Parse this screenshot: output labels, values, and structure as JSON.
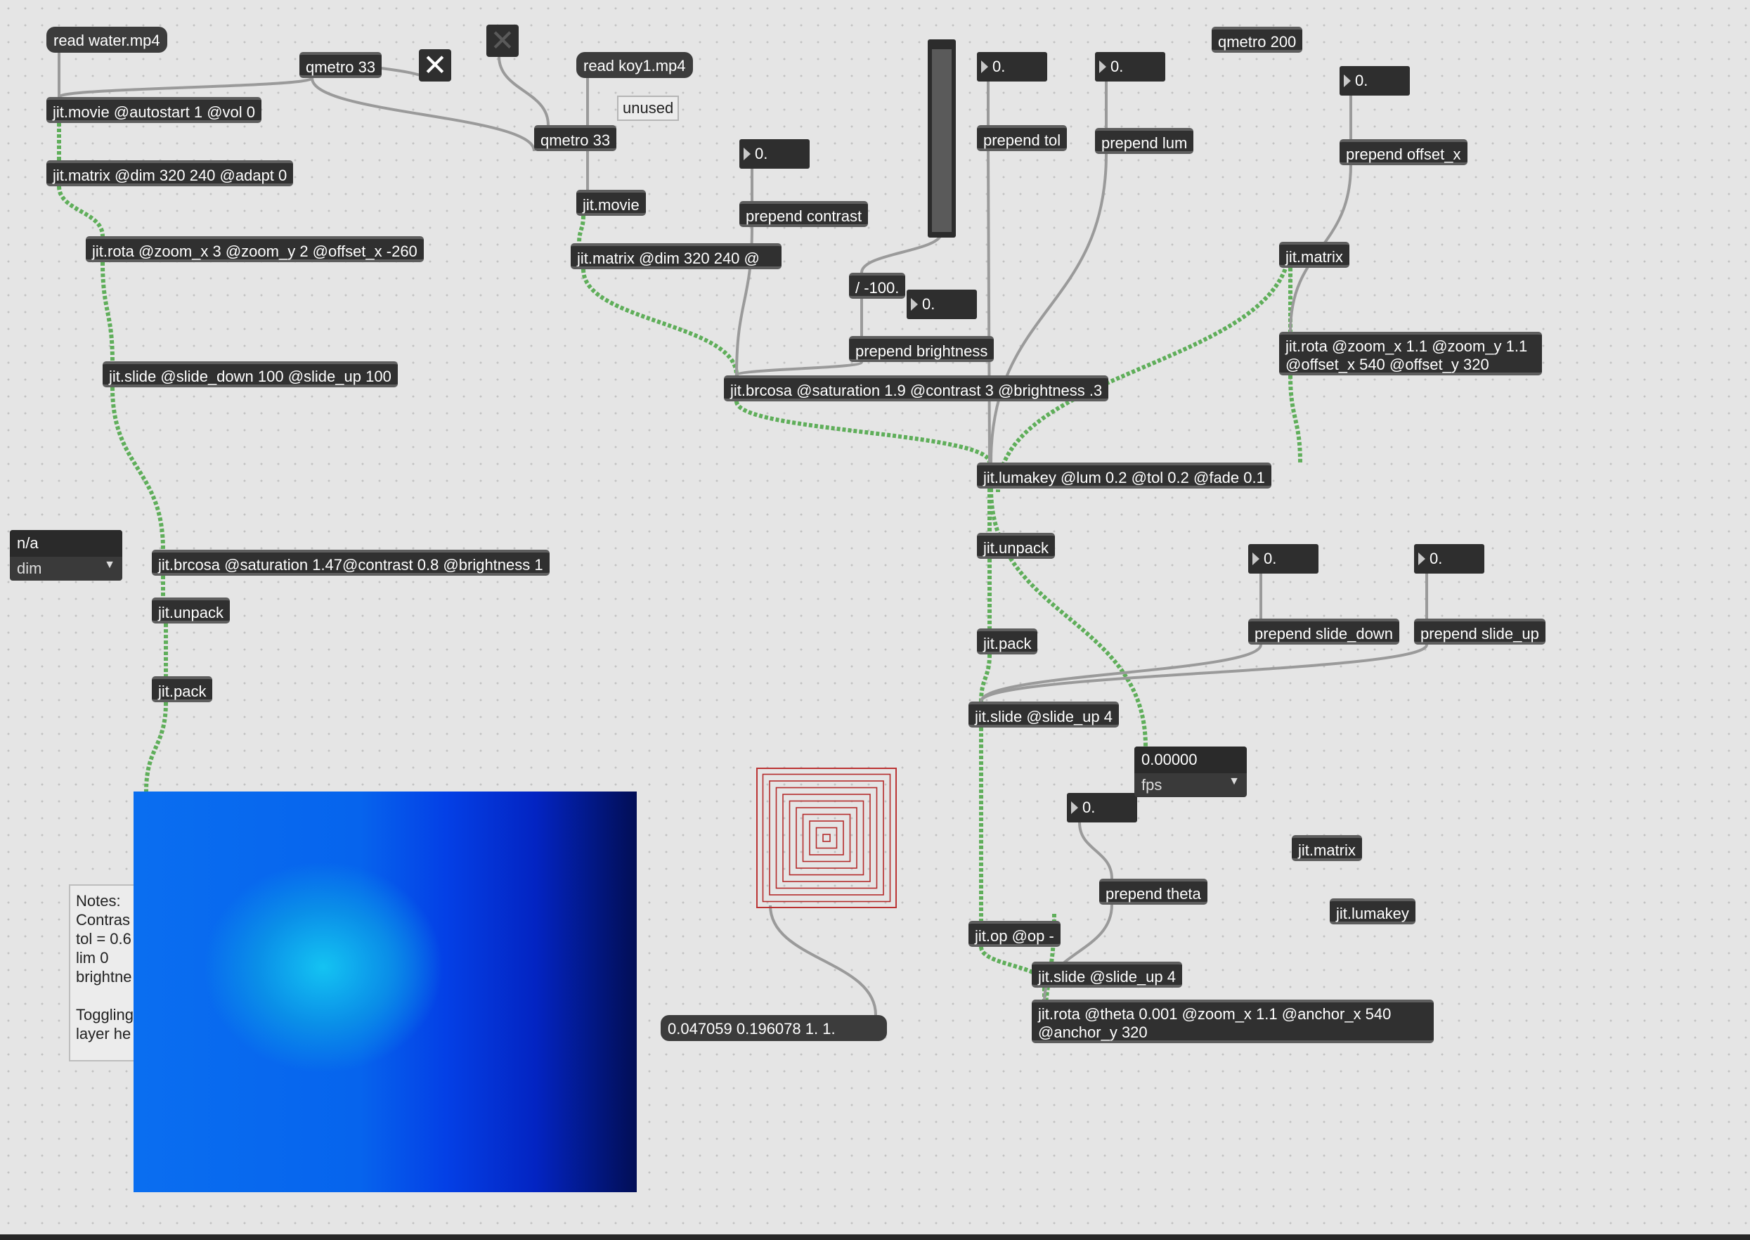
{
  "patch": {
    "objects": {
      "read_water": "read water.mp4",
      "qmetro_a": "qmetro 33",
      "read_koy": "read koy1.mp4",
      "unused": "unused",
      "qmetro_200": "qmetro 200",
      "movie_a": "jit.movie @autostart 1 @vol 0",
      "qmetro_b": "qmetro 33",
      "matrix_a": "jit.matrix @dim 320 240 @adapt 0",
      "movie_b": "jit.movie",
      "matrix_b": "jit.matrix @dim 320 240 @",
      "prepend_contrast": "prepend contrast",
      "prepend_tol": "prepend tol",
      "prepend_lum": "prepend lum",
      "prepend_offset_x": "prepend offset_x",
      "rota_a": "jit.rota @zoom_x 3 @zoom_y 2 @offset_x -260",
      "divide": "/ -100.",
      "jit_matrix_r": "jit.matrix",
      "slide_a": "jit.slide @slide_down 100 @slide_up 100",
      "prepend_brightness": "prepend brightness",
      "rota_b": "jit.rota @zoom_x 1.1 @zoom_y 1.1 @offset_x 540 @offset_y 320",
      "brcosa_b": "jit.brcosa @saturation 1.9 @contrast 3 @brightness .3",
      "lumakey": "jit.lumakey @lum 0.2 @tol 0.2 @fade 0.1",
      "unpack_b": "jit.unpack",
      "brcosa_a": "jit.brcosa @saturation 1.47@contrast 0.8 @brightness 1",
      "unpack_a": "jit.unpack",
      "pack_b": "jit.pack",
      "prepend_slide_down": "prepend slide_down",
      "prepend_slide_up": "prepend slide_up",
      "pack_a": "jit.pack",
      "slide_b": "jit.slide @slide_up 4",
      "prepend_theta": "prepend theta",
      "jit_matrix_free": "jit.matrix",
      "jit_lumakey_free": "jit.lumakey",
      "op": "jit.op @op -",
      "slide_c": "jit.slide @slide_up 4",
      "rota_c": "jit.rota @theta 0.001 @zoom_x 1.1 @anchor_x 540 @anchor_y 320",
      "color_msg": "0.047059 0.196078 1. 1."
    },
    "numbers": {
      "contrast": "0.",
      "tol": "0.",
      "lum": "0.",
      "offset_x": "0.",
      "brightness": "0.",
      "slide_down": "0.",
      "slide_up": "0.",
      "theta": "0."
    },
    "menus": {
      "dim_display": "n/a",
      "dim_select": "dim",
      "fps_display": "0.00000",
      "fps_select": "fps"
    },
    "toggles": {
      "toggle_a": "on",
      "toggle_b": "off"
    },
    "notes": "Notes:\nContras\ntol = 0.6\nlim 0\nbrightne\n\nToggling\nlayer he"
  },
  "colors": {
    "canvas": "#e5e5e5",
    "object": "#303030",
    "matrix_cord": "#5fae5a",
    "cord": "#9a9a9a",
    "window_blue": "#0664ed"
  }
}
